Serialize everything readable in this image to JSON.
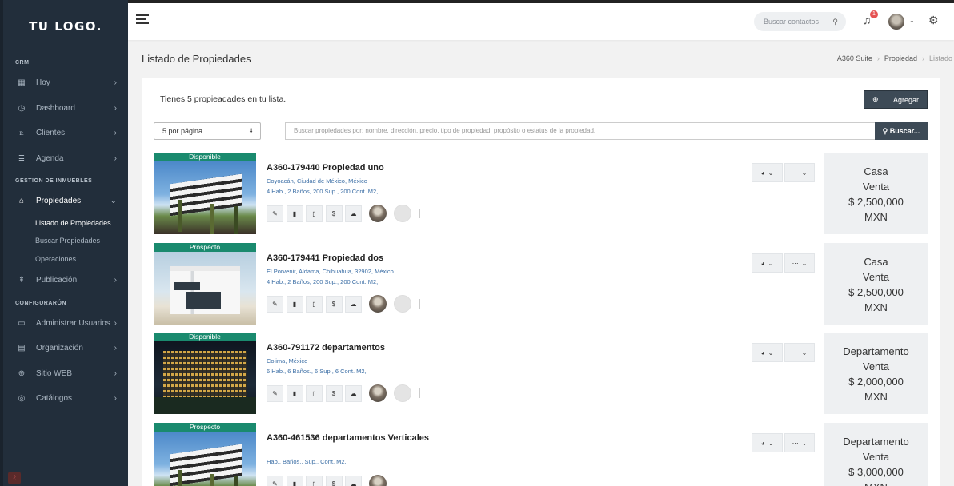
{
  "sidebar": {
    "logo": "TU LOGO.",
    "sections": {
      "crm": "CRM",
      "gestion": "GESTION DE INMUEBLES",
      "config": "CONFIGURARÓN"
    },
    "items": {
      "hoy": {
        "label": "Hoy",
        "icon": "calendar-icon"
      },
      "dashboard": {
        "label": "Dashboard",
        "icon": "dashboard-icon"
      },
      "clientes": {
        "label": "Clientes",
        "icon": "users-icon"
      },
      "agenda": {
        "label": "Agenda",
        "icon": "list-icon"
      },
      "propiedades": {
        "label": "Propiedades",
        "icon": "home-icon"
      },
      "publicacion": {
        "label": "Publicación",
        "icon": "upload-icon"
      },
      "usuarios": {
        "label": "Administrar Usuarios",
        "icon": "wallet-icon"
      },
      "organizacion": {
        "label": "Organización",
        "icon": "building-icon"
      },
      "sitio": {
        "label": "Sitio WEB",
        "icon": "globe-icon"
      },
      "catalogos": {
        "label": "Catálogos",
        "icon": "catalog-icon"
      }
    },
    "sub_items": {
      "listado": "Listado de Propiedades",
      "buscar": "Buscar Propiedades",
      "operaciones": "Operaciones"
    }
  },
  "topbar": {
    "search_placeholder": "Buscar contactos",
    "notifications_count": "1"
  },
  "page": {
    "title": "Listado de Propiedades",
    "breadcrumb": [
      "A360 Suite",
      "Propiedad",
      "Listado"
    ]
  },
  "list": {
    "summary": "Tienes 5 propieadades en tu lista.",
    "add_label": "Agregar",
    "per_page": "5 por página",
    "search_placeholder": "Buscar propiedades por: nombre, dirección, precio, tipo de propiedad, propósito o estatus de la propiedad.",
    "search_button": "Buscar..."
  },
  "properties": [
    {
      "status": "Disponible",
      "title": "A360-179440 Propiedad uno",
      "location": "Coyoacán, Ciudad de México, México",
      "features": "4 Hab., 2 Baños, 200 Sup., 200 Cont. M2,",
      "type": "Casa",
      "operation": "Venta",
      "price": "$ 2,500,000",
      "currency": "MXN"
    },
    {
      "status": "Prospecto",
      "title": "A360-179441 Propiedad dos",
      "location": "El Porvenir, Aldama, Chihuahua, 32902, México",
      "features": "4 Hab., 2 Baños, 200 Sup., 200 Cont. M2,",
      "type": "Casa",
      "operation": "Venta",
      "price": "$ 2,500,000",
      "currency": "MXN"
    },
    {
      "status": "Disponible",
      "title": "A360-791172 departamentos",
      "location": "Colima, México",
      "features": "6 Hab., 6 Baños., 6 Sup., 6 Cont. M2,",
      "type": "Departamento",
      "operation": "Venta",
      "price": "$ 2,000,000",
      "currency": "MXN"
    },
    {
      "status": "Prospecto",
      "title": "A360-461536 departamentos Verticales",
      "location": "",
      "features": "Hab., Baños., Sup., Cont. M2,",
      "type": "Departamento",
      "operation": "Venta",
      "price": "$ 3,000,000",
      "currency": "MXN"
    }
  ],
  "colors": {
    "sidebar": "#222e3b",
    "status_badge": "#1a8a6e",
    "button_dark": "#3d4a56",
    "link_blue": "#3b6ea5"
  }
}
